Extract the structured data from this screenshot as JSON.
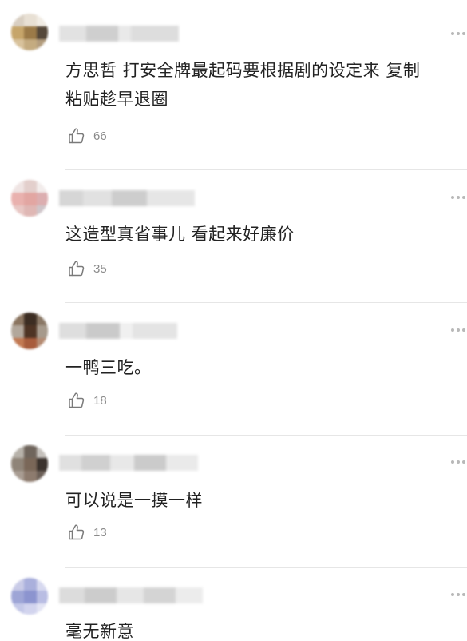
{
  "colors": {
    "text": "#222222",
    "muted": "#8a8a8a",
    "divider": "#e6e6e6",
    "icon": "#7a7a7a"
  },
  "comments": [
    {
      "username": "",
      "text_line1": "方思哲 打安全牌最起码要根据剧的设定来 复制",
      "text_line2": "粘贴趁早退圈",
      "likes": "66"
    },
    {
      "username": "",
      "text_line1": "这造型真省事儿 看起来好廉价",
      "likes": "35"
    },
    {
      "username": "",
      "text_line1": "一鸭三吃。",
      "likes": "18"
    },
    {
      "username": "",
      "text_line1": "可以说是一摸一样",
      "likes": "13"
    },
    {
      "username": "",
      "text_line1": "毫无新意"
    }
  ]
}
